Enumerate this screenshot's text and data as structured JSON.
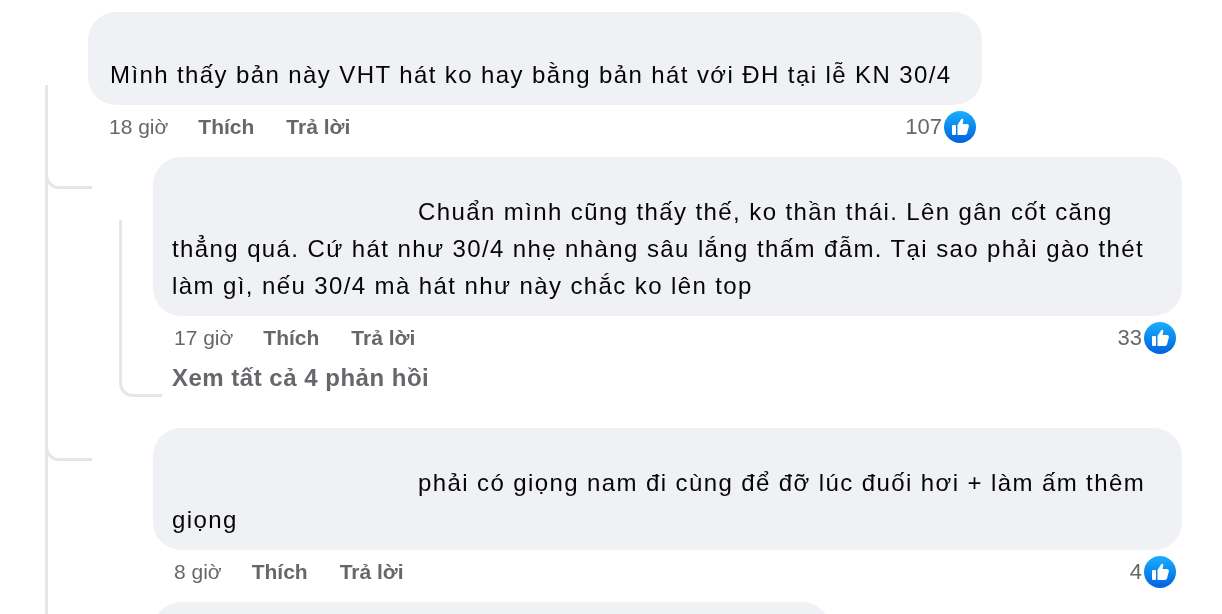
{
  "comment": {
    "text": "Mình thấy bản này VHT hát ko hay bằng bản hát với ĐH tại lễ KN 30/4",
    "time": "18 giờ",
    "like": "Thích",
    "reply": "Trả lời",
    "likes": "107"
  },
  "replies": [
    {
      "text": "Chuẩn mình cũng thấy thế, ko thần thái. Lên gân cốt căng thẳng quá. Cứ hát như 30/4 nhẹ nhàng sâu lắng thấm đẫm. Tại sao phải gào thét làm gì, nếu 30/4 mà hát như này chắc ko lên top",
      "time": "17 giờ",
      "like": "Thích",
      "reply": "Trả lời",
      "likes": "33",
      "more_replies": "Xem tất cả 4 phản hồi"
    },
    {
      "text": "phải có giọng nam đi cùng để đỡ lúc đuối hơi + làm ấm thêm giọng",
      "time": "8 giờ",
      "like": "Thích",
      "reply": "Trả lời",
      "likes": "4"
    }
  ]
}
